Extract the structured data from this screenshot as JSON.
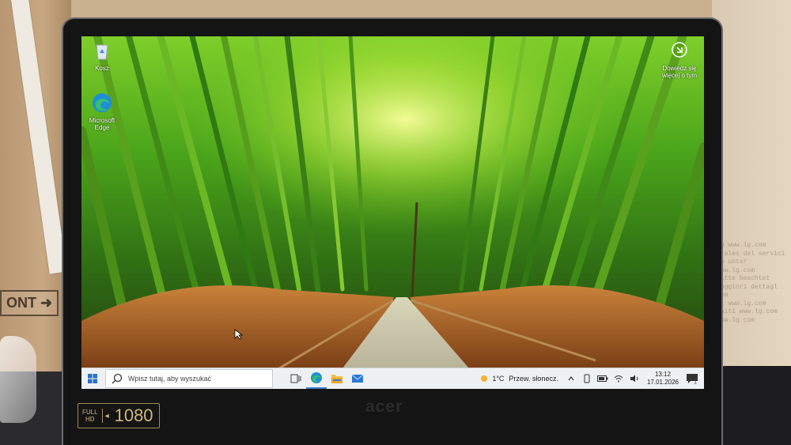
{
  "background": {
    "box_text": "ONT",
    "box_arrow": "➜",
    "box_print": "on www.lg.com\nerales del servici\nLG unter www.lg.com\nBitte beachtet\nmaggiori dettagl\ncom\nit www.lg.com\ncaiti www.lg.com\nwww.lg.com"
  },
  "laptop": {
    "brand": "acer",
    "fhd_top": "FULL",
    "fhd_bottom": "HD",
    "fhd_value": "1080"
  },
  "desktop": {
    "icons": [
      {
        "name": "recycle-bin",
        "label": "Kosz"
      },
      {
        "name": "microsoft-edge",
        "label": "Microsoft Edge"
      }
    ],
    "notice": {
      "label": "Dowiedz się więcej o tym"
    }
  },
  "taskbar": {
    "search_placeholder": "Wpisz tutaj, aby wyszukać",
    "weather_temp": "1°C",
    "weather_desc": "Przew. słonecz.",
    "time": "13:12",
    "date": "17.01.2026",
    "notification_count": "1"
  },
  "colors": {
    "taskbar_bg": "#eef1f3",
    "accent": "#3c7bd0"
  }
}
